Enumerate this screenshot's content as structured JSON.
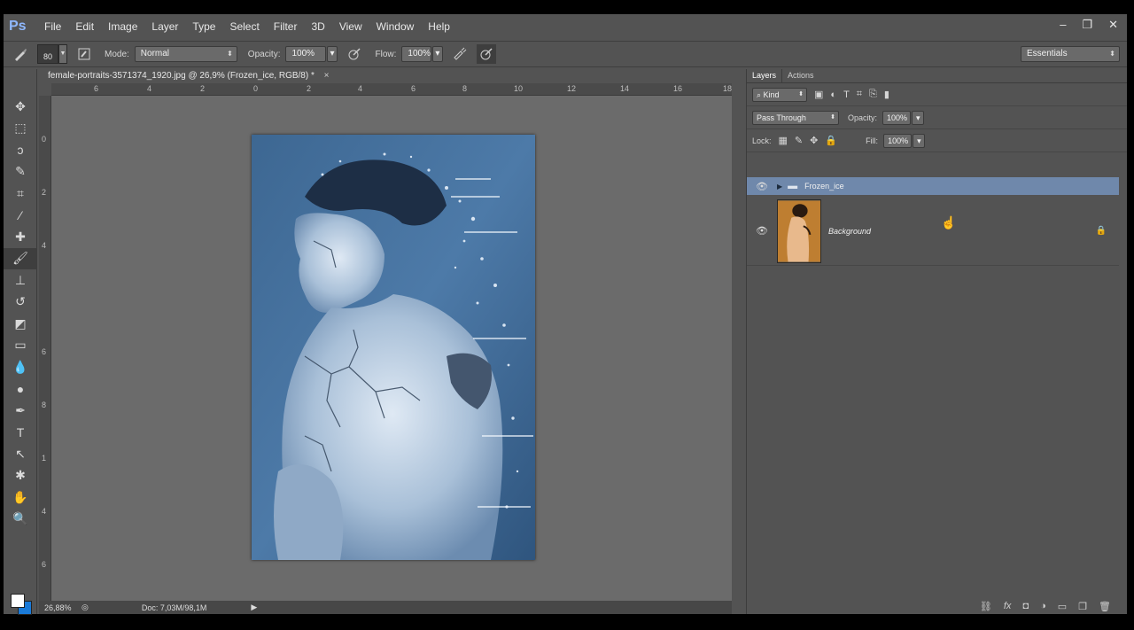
{
  "app": {
    "logo": "Ps"
  },
  "menu": [
    "File",
    "Edit",
    "Image",
    "Layer",
    "Type",
    "Select",
    "Filter",
    "3D",
    "View",
    "Window",
    "Help"
  ],
  "window_controls": {
    "minimize": "–",
    "restore": "❐",
    "close": "✕"
  },
  "options": {
    "brush_size": "80",
    "mode_label": "Mode:",
    "mode_value": "Normal",
    "opacity_label": "Opacity:",
    "opacity_value": "100%",
    "flow_label": "Flow:",
    "flow_value": "100%",
    "workspace": "Essentials"
  },
  "document": {
    "tab_title": "female-portraits-3571374_1920.jpg @ 26,9% (Frozen_ice, RGB/8) *",
    "ruler_h": [
      "6",
      "4",
      "2",
      "0",
      "2",
      "4",
      "6",
      "8",
      "10",
      "12",
      "14",
      "16",
      "18"
    ],
    "ruler_v": [
      "0",
      "2",
      "4",
      "6",
      "8",
      "1",
      "4",
      "6"
    ],
    "zoom": "26,88%",
    "doc_info": "Doc: 7,03M/98,1M"
  },
  "layers_panel": {
    "tabs": [
      "Layers",
      "Actions"
    ],
    "filter_kind": "Kind",
    "blend_mode": "Pass Through",
    "opacity_label": "Opacity:",
    "opacity_value": "100%",
    "lock_label": "Lock:",
    "fill_label": "Fill:",
    "fill_value": "100%",
    "layers": [
      {
        "name": "Frozen_ice",
        "type": "group",
        "selected": true
      },
      {
        "name": "Background",
        "type": "image",
        "locked": true
      }
    ]
  },
  "colors": {
    "foreground": "#ffffff",
    "background": "#1a7ad8",
    "selected_layer": "#6f88ab"
  }
}
